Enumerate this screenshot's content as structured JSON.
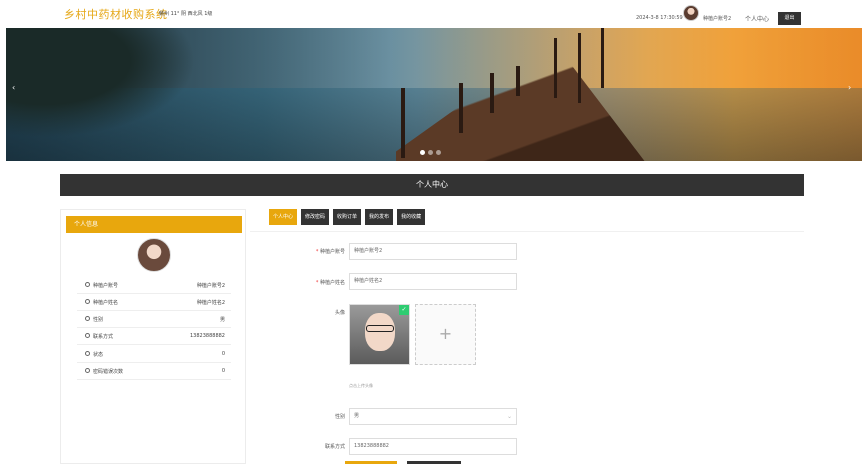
{
  "header": {
    "brand": "乡村中药材收购系统",
    "weather": "赣州 11° 阴 西北风 1级",
    "datetime": "2024-3-8 17:30:59",
    "username": "种植户账号2",
    "center_link": "个人中心",
    "logout": "退出"
  },
  "banner": {
    "prev": "‹",
    "next": "›",
    "slide_count": 3,
    "active_slide": 1
  },
  "section_title": "个人中心",
  "sidebar": {
    "title": "个人信息",
    "rows": [
      {
        "label": "种植户账号",
        "value": "种植户账号2"
      },
      {
        "label": "种植户姓名",
        "value": "种植户姓名2"
      },
      {
        "label": "性别",
        "value": "男"
      },
      {
        "label": "联系方式",
        "value": "13823888882"
      },
      {
        "label": "状态",
        "value": "0"
      },
      {
        "label": "密码错误次数",
        "value": "0"
      }
    ]
  },
  "tabs": [
    "个人中心",
    "修改密码",
    "收购订单",
    "我的发布",
    "我的收藏"
  ],
  "form": {
    "account_label": "种植户账号",
    "account_value": "种植户账号2",
    "name_label": "种植户姓名",
    "name_value": "种植户姓名2",
    "avatar_label": "头像",
    "upload_plus": "+",
    "upload_hint": "点击上传头像",
    "gender_label": "性别",
    "gender_value": "男",
    "gender_arrow": "⌄",
    "phone_label": "联系方式",
    "phone_value": "13823888882"
  },
  "colors": {
    "accent": "#e8a70d",
    "dark": "#333333"
  }
}
